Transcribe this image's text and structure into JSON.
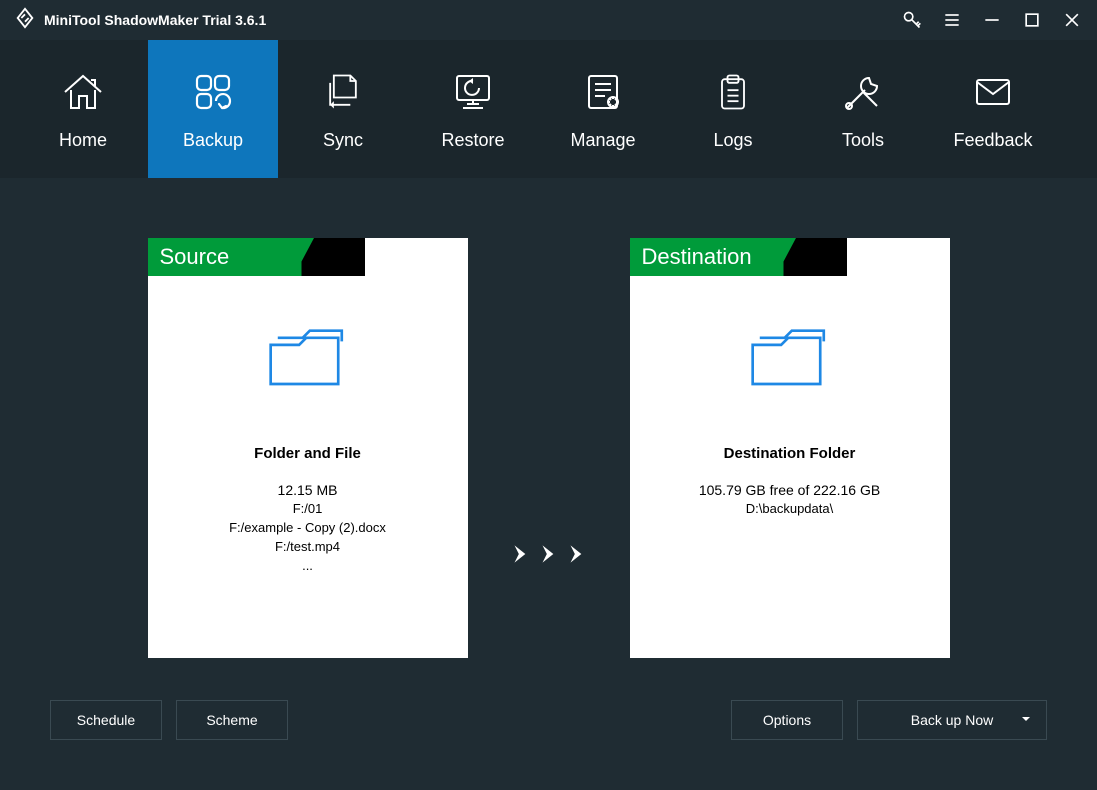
{
  "titlebar": {
    "title": "MiniTool ShadowMaker Trial 3.6.1"
  },
  "tabs": [
    {
      "id": "home",
      "label": "Home"
    },
    {
      "id": "backup",
      "label": "Backup"
    },
    {
      "id": "sync",
      "label": "Sync"
    },
    {
      "id": "restore",
      "label": "Restore"
    },
    {
      "id": "manage",
      "label": "Manage"
    },
    {
      "id": "logs",
      "label": "Logs"
    },
    {
      "id": "tools",
      "label": "Tools"
    },
    {
      "id": "feedback",
      "label": "Feedback"
    }
  ],
  "activeTab": "backup",
  "source": {
    "header": "Source",
    "title": "Folder and File",
    "size": "12.15 MB",
    "lines": [
      "F:/01",
      "F:/example - Copy (2).docx",
      "F:/test.mp4",
      "..."
    ]
  },
  "destination": {
    "header": "Destination",
    "title": "Destination Folder",
    "freeline": "105.79 GB free of 222.16 GB",
    "path": "D:\\backupdata\\"
  },
  "buttons": {
    "schedule": "Schedule",
    "scheme": "Scheme",
    "options": "Options",
    "backupnow": "Back up Now"
  }
}
